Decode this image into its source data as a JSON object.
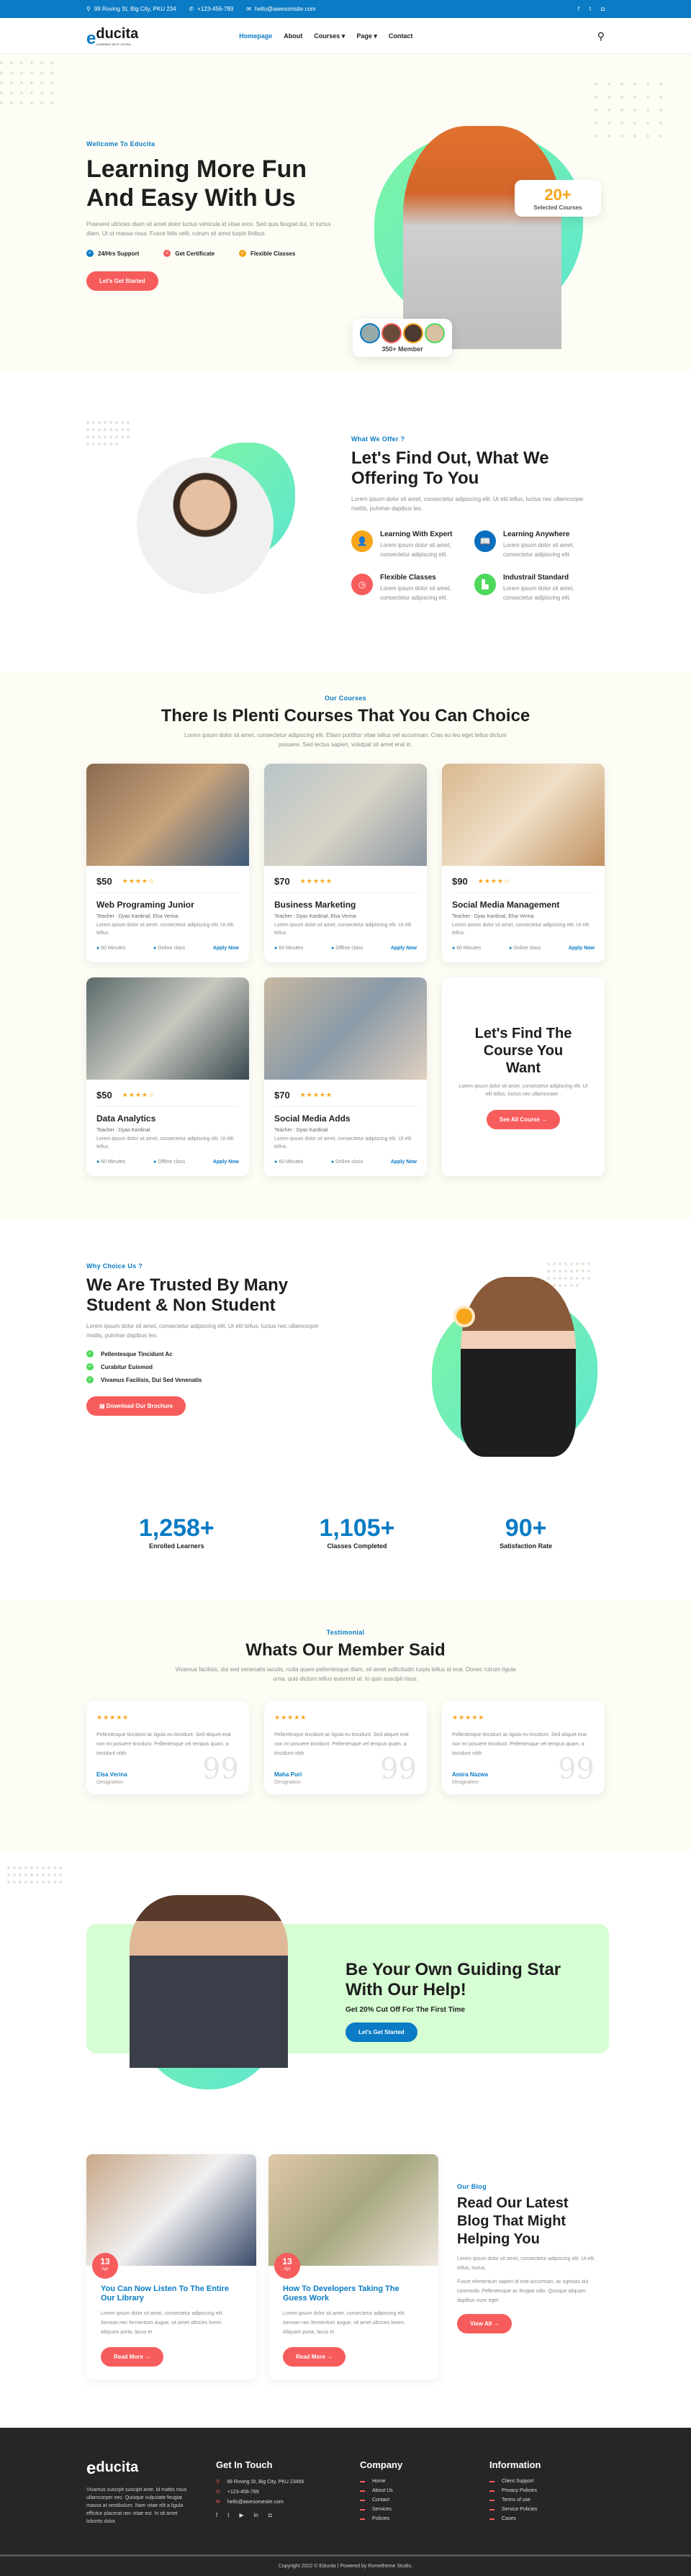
{
  "topbar": {
    "address": "99 Roving St, Big City, PKU 234",
    "phone": "+123-456-789",
    "email": "hello@awesomsite.com",
    "social": [
      "facebook-icon",
      "twitter-icon",
      "instagram-icon"
    ]
  },
  "nav": {
    "logo": "ducita",
    "logo_letter": "e",
    "logo_tagline": "LEARNING WITH JOYFUL",
    "items": [
      {
        "label": "Homepage",
        "active": true
      },
      {
        "label": "About"
      },
      {
        "label": "Courses ▾"
      },
      {
        "label": "Page ▾"
      },
      {
        "label": "Contact"
      }
    ]
  },
  "hero": {
    "eyebrow": "Wellcome To Educita",
    "title": "Learning More Fun And Easy With Us",
    "text": "Praesent ultricies diam sit amet dolor luctus vehicula id vitae eros. Sed quis feugiat dui, in luctus diam. Ut ut massa risus. Fusce felis velit, rutrum sit amet turpis finibus.",
    "checks": [
      "24/Hrs Support",
      "Get Certificate",
      "Flexible Classes"
    ],
    "cta": "Let's Get Started",
    "courses_count": "20+",
    "courses_label": "Selected Courses",
    "members_label": "350+ Member"
  },
  "offer": {
    "eyebrow": "What We Offer ?",
    "title": "Let's Find Out, What We Offering To You",
    "text": "Lorem ipsum dolor sit amet, consectetur adipiscing elit. Ut elit tellus, luctus nec ullamcorper mattis, pulvinar dapibus leo.",
    "features": [
      {
        "title": "Learning With Expert",
        "text": "Lorem ipsum dolor sit amet, consectetur adipiscing elit.",
        "color": "#f7a51a"
      },
      {
        "title": "Learning Anywhere",
        "text": "Lorem ipsum dolor sit amet, consectetur adipiscing elit.",
        "color": "#0a6dbd"
      },
      {
        "title": "Flexible Classes",
        "text": "Lorem ipsum dolor sit amet, consectetur adipiscing elit.",
        "color": "#f75c5c"
      },
      {
        "title": "Industrail Standard",
        "text": "Lorem ipsum dolor sit amet, consectetur adipiscing elit.",
        "color": "#4ed85a"
      }
    ]
  },
  "courses": {
    "eyebrow": "Our Courses",
    "title": "There Is Plenti Courses That You Can Choice",
    "text": "Lorem ipsum dolor sit amet, consectetur adipiscing elit. Etiam porttitor vitae tellus vel accumsan. Cras eu leo eget tellus dictum posuere. Sed lectus sapien, volutpat sit amet erat in.",
    "items": [
      {
        "price": "$50",
        "stars": "★★★★☆",
        "title": "Web Programing Junior",
        "teacher": "Teacher : Dyas Kardinal, Elsa Verina",
        "text": "Lorem ipsum dolor sit amet, consectetur adipiscing elit. Ut elit tellus.",
        "duration": "60 Minutes",
        "mode": "Online class",
        "apply": "Apply Now"
      },
      {
        "price": "$70",
        "stars": "★★★★★",
        "title": "Business Marketing",
        "teacher": "Teacher : Dyas Kardinal, Elsa Verina",
        "text": "Lorem ipsum dolor sit amet, consectetur adipiscing elit. Ut elit tellus.",
        "duration": "60 Minutes",
        "mode": "Offline class",
        "apply": "Apply Now"
      },
      {
        "price": "$90",
        "stars": "★★★★☆",
        "title": "Social Media Management",
        "teacher": "Teacher : Dyas Kardinal, Elsa Verina",
        "text": "Lorem ipsum dolor sit amet, consectetur adipiscing elit. Ut elit tellus.",
        "duration": "60 Minutes",
        "mode": "Online class",
        "apply": "Apply Now"
      },
      {
        "price": "$50",
        "stars": "★★★★☆",
        "title": "Data Analytics",
        "teacher": "Teacher : Dyas Kardinal",
        "text": "Lorem ipsum dolor sit amet, consectetur adipiscing elit. Ut elit tellus.",
        "duration": "60 Minutes",
        "mode": "Offline class",
        "apply": "Apply Now"
      },
      {
        "price": "$70",
        "stars": "★★★★★",
        "title": "Social Media Adds",
        "teacher": "Teacher : Dyas Kardinal",
        "text": "Lorem ipsum dolor sit amet, consectetur adipiscing elit. Ut elit tellus.",
        "duration": "60 Minutes",
        "mode": "Online class",
        "apply": "Apply Now"
      }
    ],
    "find_title": "Let's Find The Course You Want",
    "find_text": "Lorem ipsum dolor sit amet, consectetur adipiscing elit. Ut elit tellus, luctus nec ullamcorper .",
    "find_cta": "See All Course →"
  },
  "why": {
    "eyebrow": "Why Choice Us ?",
    "title": "We Are Trusted By Many Student & Non Student",
    "text": "Lorem ipsum dolor sit amet, consectetur adipiscing elit. Ut elit tellus, luctus nec ullamcorper mattis, pulvinar dapibus leo.",
    "list": [
      "Pellentesque Tincidunt Ac",
      "Curabitur Euismod",
      "Vivamus Facilisis, Dui Sed Venenatis"
    ],
    "cta": "Download Our Brochure"
  },
  "stats": [
    {
      "value": "1,258+",
      "label": "Enrolled Learners"
    },
    {
      "value": "1,105+",
      "label": "Classes Completed"
    },
    {
      "value": "90+",
      "label": "Satisfaction Rate"
    }
  ],
  "testimonial": {
    "eyebrow": "Testimonial",
    "title": "Whats Our Member Said",
    "text": "Vivamus facilisis, dui sed venenatis iaculis, nulla quam pellentesque diam, sit amet sollicitudin turpis tellus id erat. Donec rutrum ligula urna, quis dictum tellus euismod at. In quis suscipit risus.",
    "items": [
      {
        "stars": "★★★★★",
        "text": "Pellentesque tincidunt ac ligula eu tincidunt. Sed aliquet erat non mi posuere tincidunt. Pellentesque vel tempus quam, a tincidunt nibh",
        "name": "Elsa Verina",
        "designation": "Designation"
      },
      {
        "stars": "★★★★★",
        "text": "Pellentesque tincidunt ac ligula eu tincidunt. Sed aliquet erat non mi posuere tincidunt. Pellentesque vel tempus quam, a tincidunt nibh",
        "name": "Maha Puri",
        "designation": "Designation"
      },
      {
        "stars": "★★★★★",
        "text": "Pellentesque tincidunt ac ligula eu tincidunt. Sed aliquet erat non mi posuere tincidunt. Pellentesque vel tempus quam, a tincidunt nibh",
        "name": "Amira Nazwa",
        "designation": "Designation"
      }
    ]
  },
  "cta": {
    "title": "Be Your Own Guiding Star With Our Help!",
    "subtitle": "Get 20% Cut Off For The First Time",
    "button": "Let's Get Started"
  },
  "blog": {
    "eyebrow": "Our Blog",
    "title": "Read Our Latest Blog That Might Helping You",
    "text1": "Lorem ipsum dolor sit amet, consectetur adipiscing elit. Ut elit tellus, luctus.",
    "text2": "Fusce elementum sapien id erat accumsan, ac egestas dui commodo. Pellentesque ac feugiat odio. Quisque aliquam dapibus nunc eget.",
    "view_all": "View All →",
    "posts": [
      {
        "day": "13",
        "month": "Apr",
        "title": "You Can Now Listen To The Entire Our Library",
        "text": "Lorem ipsum dolor sit amet, consectetur adipiscing elit. Aenean nec fermentum augue, sit amet ultricies lorem. Aliquam porta, lacus et",
        "cta": "Read More →"
      },
      {
        "day": "13",
        "month": "Apr",
        "title": "How To Developers Taking The Guess Work",
        "text": "Lorem ipsum dolor sit amet, consectetur adipiscing elit. Aenean nec fermentum augue, sit amet ultricies lorem. Aliquam porta, lacus et",
        "cta": "Read More →"
      }
    ]
  },
  "footer": {
    "about": "Vivamus suscipit suscipit ante, id mattis risus ullamcorper nec. Quisque vulputate feugiat massa at vestibulum. Nam vitae elit a ligula efficitur placerat nec vitae est. In sit amet lobortis dolor.",
    "contact_title": "Get In Touch",
    "address": "99 Roving St, Big City, PKU 23456",
    "phone": "+123-456-789",
    "email": "hello@awesomesite.com",
    "company_title": "Company",
    "company": [
      "Home",
      "About Us",
      "Contact",
      "Services",
      "Policies"
    ],
    "info_title": "Information",
    "info": [
      "Client Support",
      "Privacy Policies",
      "Terms of use",
      "Service Policies",
      "Cases"
    ],
    "copyright": "Copyright 2022 © Educita | Powered by Rometheme Studio."
  },
  "colors": {
    "primary": "#0a7bc4",
    "accent": "#f75c5c",
    "star": "#f7a51a",
    "cream": "#fdfdf5",
    "mint": "#7df5a5",
    "dark": "#262626"
  }
}
